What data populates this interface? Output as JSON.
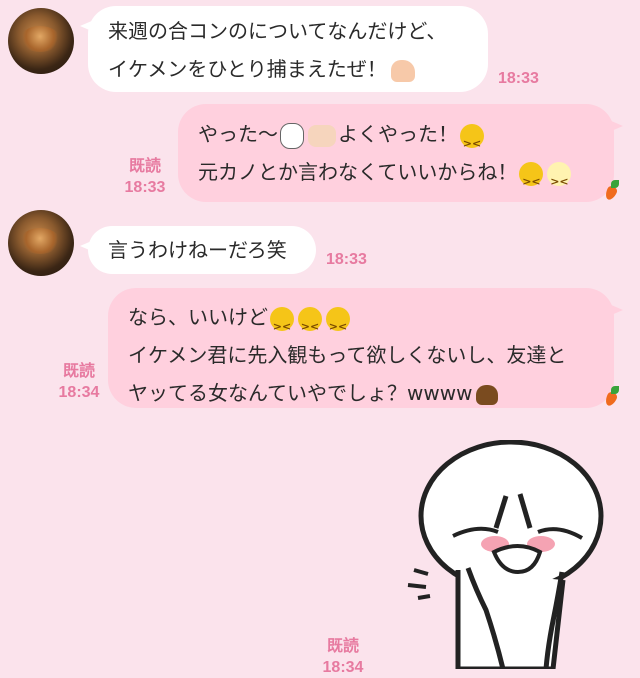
{
  "messages": [
    {
      "id": "m1",
      "direction": "incoming",
      "lines": [
        "来週の合コンのについてなんだけど、",
        "イケメンをひとり捕まえたぜ！"
      ],
      "time": "18:33",
      "emoji": [
        "muscle-icon"
      ]
    },
    {
      "id": "m2",
      "direction": "outgoing",
      "lines": [
        "やった〜",
        "よくやった！",
        "元カノとか言わなくていいからね！"
      ],
      "time": "18:33",
      "read": "既読",
      "emoji": [
        "bunny-face-icon",
        "clapping-hands-icon",
        "angry-face-icon",
        "crying-face-icon",
        "fuming-face-icon",
        "carrot-icon"
      ]
    },
    {
      "id": "m3",
      "direction": "incoming",
      "lines": [
        "言うわけねーだろ笑"
      ],
      "time": "18:33"
    },
    {
      "id": "m4",
      "direction": "outgoing",
      "lines": [
        "なら、いいけど",
        "イケメン君に先入観もって欲しくないし、友達と",
        "ヤッてる女なんていやでしょ？wwww"
      ],
      "time": "18:34",
      "read": "既読",
      "emoji": [
        "angry-face-icon",
        "poop-icon",
        "carrot-icon"
      ]
    },
    {
      "id": "m5",
      "direction": "outgoing",
      "type": "sticker",
      "sticker": "moon-character-cringing",
      "time": "18:34",
      "read": "既読"
    }
  ],
  "colors": {
    "background": "#fbe3ec",
    "incoming_bubble": "#ffffff",
    "outgoing_bubble": "#ffd0de",
    "meta": "#e77aa0"
  }
}
